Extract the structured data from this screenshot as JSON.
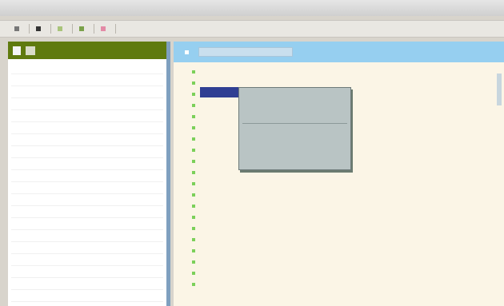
{
  "window": {
    "title": ""
  },
  "toolbar": {
    "buttons": [
      "",
      "",
      "",
      "",
      ""
    ]
  },
  "left": {
    "header": {
      "btn_a": "",
      "btn_b": ""
    },
    "rows": [
      "",
      "",
      "",
      "",
      "",
      "",
      "",
      "",
      "",
      "",
      "",
      "",
      "",
      "",
      "",
      "",
      "",
      "",
      "",
      ""
    ]
  },
  "right": {
    "header": {
      "label": "",
      "search_placeholder": ""
    },
    "rows": [
      "",
      "",
      "",
      "",
      "",
      "",
      "",
      "",
      "",
      "",
      "",
      "",
      "",
      "",
      "",
      "",
      "",
      "",
      "",
      ""
    ]
  },
  "context_menu": {
    "items": [
      "",
      "",
      "",
      "",
      "",
      ""
    ]
  },
  "selected_row": {
    "text": ""
  },
  "colors": {
    "left_header": "#5f7a0e",
    "right_header": "#96cff0",
    "selection": "#2f3f93",
    "menu": "#b9c4c4",
    "status_dot": "#7bd05a"
  }
}
